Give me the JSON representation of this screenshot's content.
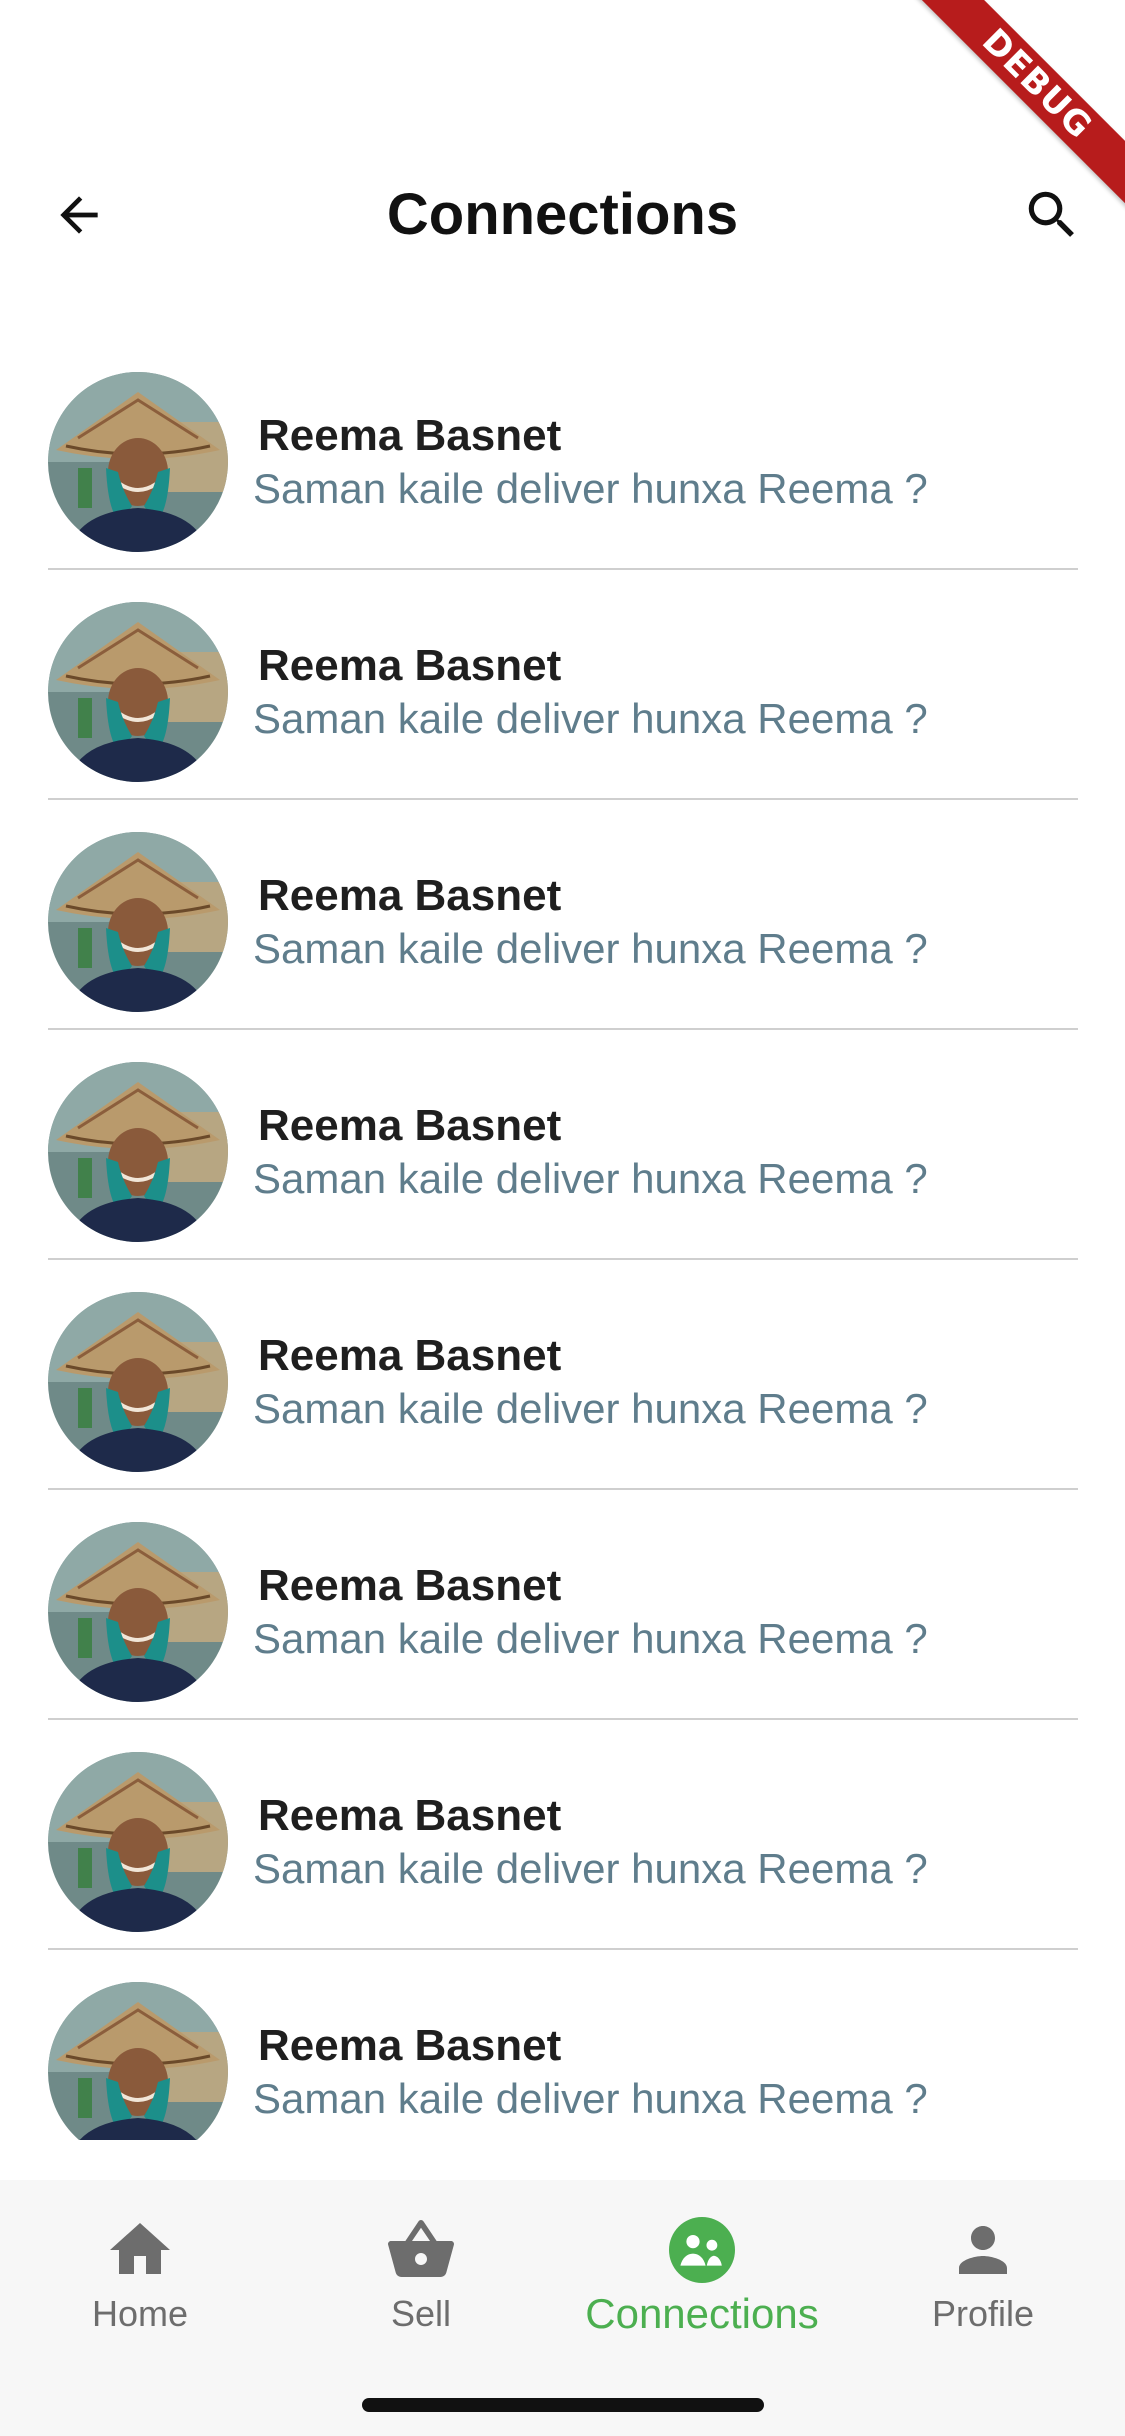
{
  "debug_banner": "DEBUG",
  "header": {
    "title": "Connections",
    "back_icon": "arrow-back-icon",
    "search_icon": "search-icon"
  },
  "connections": [
    {
      "name": "Reema Basnet",
      "message": "Saman kaile deliver hunxa Reema ?"
    },
    {
      "name": "Reema Basnet",
      "message": "Saman kaile deliver hunxa Reema ?"
    },
    {
      "name": "Reema Basnet",
      "message": "Saman kaile deliver hunxa Reema ?"
    },
    {
      "name": "Reema Basnet",
      "message": "Saman kaile deliver hunxa Reema ?"
    },
    {
      "name": "Reema Basnet",
      "message": "Saman kaile deliver hunxa Reema ?"
    },
    {
      "name": "Reema Basnet",
      "message": "Saman kaile deliver hunxa Reema ?"
    },
    {
      "name": "Reema Basnet",
      "message": "Saman kaile deliver hunxa Reema ?"
    },
    {
      "name": "Reema Basnet",
      "message": "Saman kaile deliver hunxa Reema ?"
    }
  ],
  "bottom_nav": {
    "items": [
      {
        "label": "Home",
        "icon": "home-icon",
        "active": false
      },
      {
        "label": "Sell",
        "icon": "basket-icon",
        "active": false
      },
      {
        "label": "Connections",
        "icon": "connections-icon",
        "active": true
      },
      {
        "label": "Profile",
        "icon": "person-icon",
        "active": false
      }
    ]
  },
  "colors": {
    "accent": "#4caf50",
    "message_text": "#5f7d8c",
    "debug_ribbon": "#b71c1c",
    "nav_inactive": "#6d6d6d"
  }
}
